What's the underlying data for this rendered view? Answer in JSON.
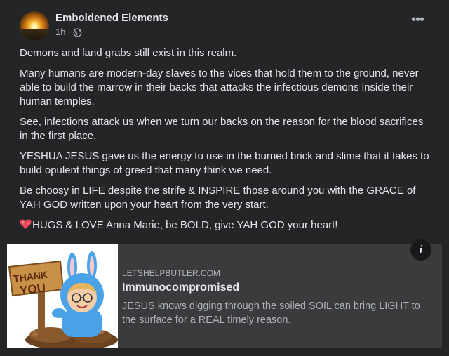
{
  "post": {
    "author": "Emboldened Elements",
    "time": "1h",
    "dot": "·",
    "privacy_icon": "globe-icon",
    "more_icon": "more-options-icon",
    "paragraphs": [
      "Demons and land grabs still exist in this realm.",
      "Many humans are modern-day slaves to the vices that hold them to the ground, never able to build the marrow in their backs that attacks the infectious demons inside their human temples.",
      "See, infections attack us when we turn our backs on the reason for the blood sacrifices in the first place.",
      "YESHUA JESUS gave us the energy to use in the burned brick and slime that it takes to build opulent things of greed that many think we need.",
      "Be choosy in LIFE despite the strife & INSPIRE those around you with the GRACE of YAH GOD written upon your heart from the very start."
    ],
    "closing": "HUGS & LOVE Anna Marie, be BOLD, give YAH GOD your heart!",
    "closing_emoji": "sparkling-heart-icon"
  },
  "link_preview": {
    "domain": "LETSHELPBUTLER.COM",
    "title": "Immunocompromised",
    "description": "JESUS knows digging through the soiled SOIL can bring LIGHT to the surface for a REAL timely reason.",
    "thumbnail_sign": [
      "THANK",
      "YOU"
    ],
    "info_glyph": "i"
  },
  "colors": {
    "card_bg": "#242526",
    "page_bg": "#18191a",
    "preview_bg": "#3a3b3c",
    "text_primary": "#e4e6eb",
    "text_secondary": "#b0b3b8"
  }
}
